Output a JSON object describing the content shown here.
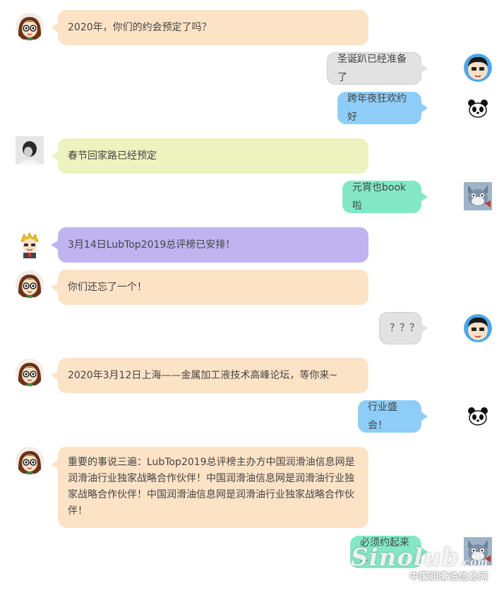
{
  "colors": {
    "peach": "#fde3c6",
    "gray": "#e2e2e2",
    "blue": "#8ecdf7",
    "lime": "#eef2bf",
    "mint": "#84e8c6",
    "purple": "#c0b3f0"
  },
  "messages": [
    {
      "side": "left",
      "avatar": "girl-glasses-avatar",
      "text": "2020年，你们的约会预定了吗？"
    },
    {
      "side": "right",
      "avatar": "boy-cartoon-avatar",
      "text": "圣诞趴已经准备了"
    },
    {
      "side": "right",
      "avatar": "panda-avatar",
      "text": "跨年夜狂欢约好"
    },
    {
      "side": "left",
      "avatar": "photo-avatar",
      "text": "春节回家路已经预定"
    },
    {
      "side": "right",
      "avatar": "cat-cartoon-avatar",
      "text": "元宵也book啦"
    },
    {
      "side": "left",
      "avatar": "blonde-boy-avatar",
      "text": "3月14日LubTop2019总评榜已安排！"
    },
    {
      "side": "left",
      "avatar": "girl-glasses-avatar",
      "text": "你们还忘了一个！"
    },
    {
      "side": "right",
      "avatar": "boy-cartoon-avatar",
      "text": "？？？"
    },
    {
      "side": "left",
      "avatar": "girl-glasses-avatar",
      "text": "2020年3月12日上海——金属加工液技术高峰论坛，等你来~"
    },
    {
      "side": "right",
      "avatar": "panda-avatar",
      "text": "行业盛会！"
    },
    {
      "side": "left",
      "avatar": "girl-glasses-avatar",
      "text": "重要的事说三遍：LubTop2019总评榜主办方中国润滑油信息网是润滑油行业独家战略合作伙伴！中国润滑油信息网是润滑油行业独家战略合作伙伴！中国润滑油信息网是润滑油行业独家战略合作伙伴！"
    },
    {
      "side": "right",
      "avatar": "cat-cartoon-avatar",
      "text": "必须约起来~"
    }
  ],
  "watermark": {
    "logo": "Sinolub",
    "sub": ".com",
    "text": "中国润滑油信息网"
  }
}
